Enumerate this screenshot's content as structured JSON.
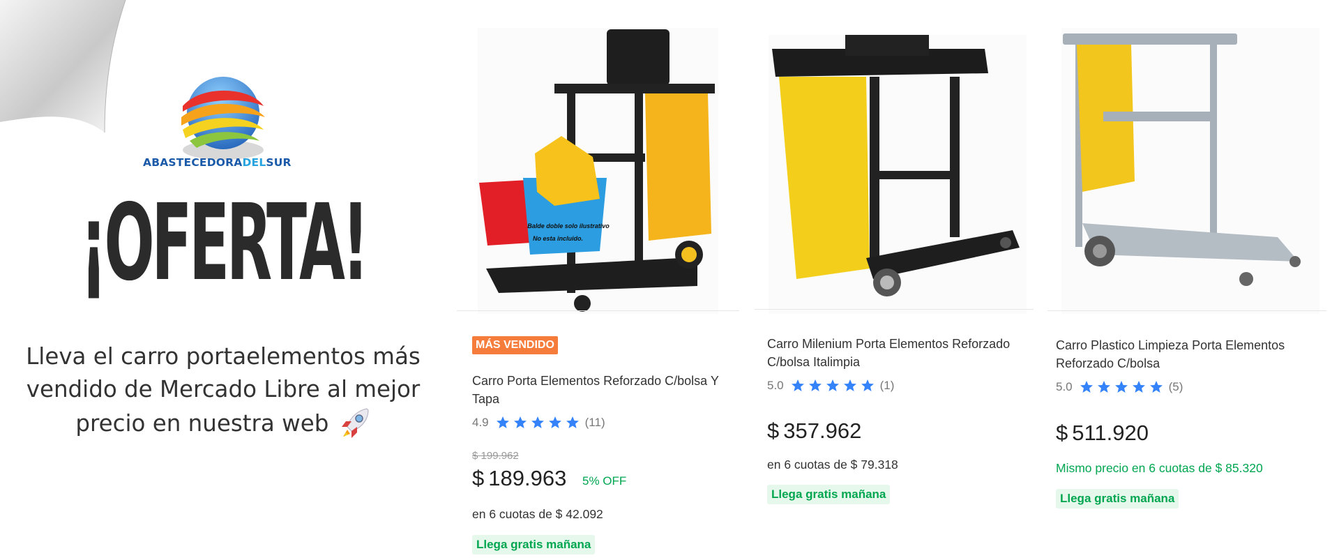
{
  "brand": {
    "name_part1": "ABASTECEDORA",
    "name_part2": "DEL",
    "name_part3": "SUR"
  },
  "promo": {
    "headline": "¡OFERTA!",
    "description": "Lleva el carro portaelementos más vendido de Mercado Libre al mejor precio en nuestra web",
    "emoji_icon": "rocket-icon"
  },
  "products": [
    {
      "badge": "MÁS VENDIDO",
      "image_caption_line1": "Balde doble solo ilustrativo",
      "image_caption_line2": "No esta incluido.",
      "title": "Carro Porta Elementos Reforzado C/bolsa Y Tapa",
      "rating": "4.9",
      "stars": 5,
      "reviews": "(11)",
      "old_price": "$ 199.962",
      "currency": "$",
      "price": "189.963",
      "discount": "5% OFF",
      "installments": "en 6 cuotas de $ 42.092",
      "shipping": "Llega gratis mañana"
    },
    {
      "title": "Carro Milenium Porta Elementos Reforzado C/bolsa Italimpia",
      "rating": "5.0",
      "stars": 5,
      "reviews": "(1)",
      "currency": "$",
      "price": "357.962",
      "installments": "en 6 cuotas de $ 79.318",
      "shipping": "Llega gratis mañana"
    },
    {
      "title": "Carro Plastico Limpieza Porta Elementos Reforzado C/bolsa",
      "rating": "5.0",
      "stars": 5,
      "reviews": "(5)",
      "currency": "$",
      "price": "511.920",
      "installments": "Mismo precio en 6 cuotas de $ 85.320",
      "shipping": "Llega gratis mañana"
    }
  ],
  "colors": {
    "badge": "#f57c3b",
    "star": "#3483fa",
    "green": "#00a650",
    "headline": "#2b2b2b"
  }
}
